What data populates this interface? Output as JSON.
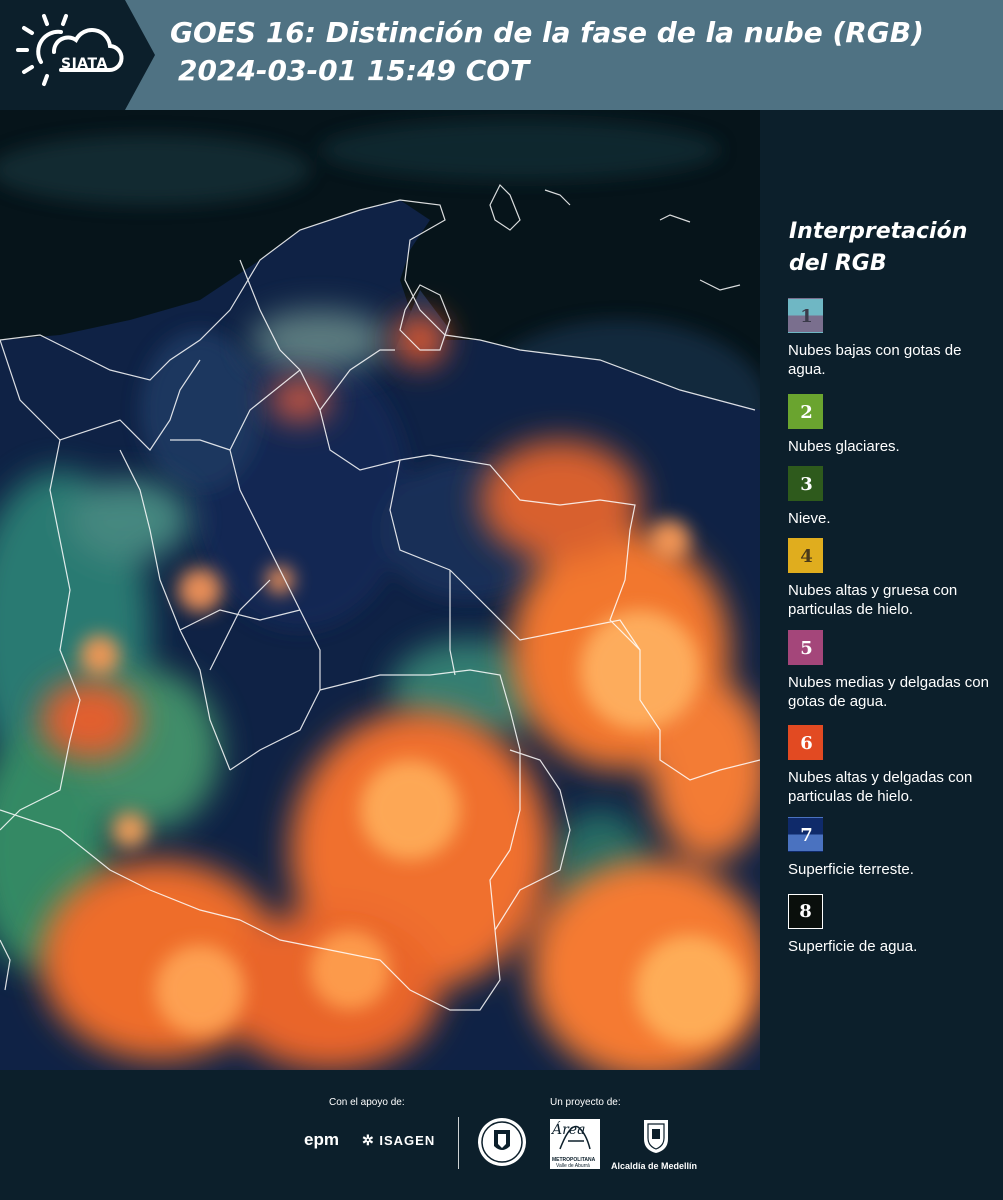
{
  "header": {
    "logo_text": "SIATA",
    "title_line1": "GOES 16: Distinción de la fase de la nube (RGB)",
    "title_line2": "2024-03-01 15:49 COT"
  },
  "map": {
    "icon": "satellite-rgb-map"
  },
  "legend": {
    "title": "Interpretación del RGB",
    "items": [
      {
        "number": "1",
        "label": "Nubes bajas con gotas de agua.",
        "top_color": "#6fb7c4",
        "bottom_color": "#7a6f8e",
        "num_color": "#3a3a4a"
      },
      {
        "number": "2",
        "label": "Nubes glaciares.",
        "top_color": "#6aa42f",
        "bottom_color": "#6aa42f",
        "num_color": "#ffffff"
      },
      {
        "number": "3",
        "label": "Nieve.",
        "top_color": "#2e5a1c",
        "bottom_color": "#2e5a1c",
        "num_color": "#ffffff"
      },
      {
        "number": "4",
        "label": "Nubes altas y gruesa con particulas de hielo.",
        "top_color": "#e0ad1e",
        "bottom_color": "#e0ad1e",
        "num_color": "#4a3a1a"
      },
      {
        "number": "5",
        "label": "Nubes medias y delgadas con gotas de agua.",
        "top_color": "#a4467a",
        "bottom_color": "#a4467a",
        "num_color": "#ffffff"
      },
      {
        "number": "6",
        "label": "Nubes altas y delgadas con particulas de hielo.",
        "top_color": "#e24a22",
        "bottom_color": "#e24a22",
        "num_color": "#ffffff"
      },
      {
        "number": "7",
        "label": "Superficie terreste.",
        "top_color": "#0f2a6a",
        "bottom_color": "#4a72c0",
        "num_color": "#ffffff"
      },
      {
        "number": "8",
        "label": "Superficie de agua.",
        "top_color": "#0a0f0c",
        "bottom_color": "#0a0f0c",
        "num_color": "#ffffff"
      }
    ]
  },
  "footer": {
    "support_label": "Con el apoyo de:",
    "project_label": "Un proyecto de:",
    "epm": "epm",
    "isagen": "ISAGEN",
    "area_word": "Área",
    "area_sub1": "METROPOLITANA",
    "area_sub2": "Valle de Aburrá",
    "alcaldia": "Alcaldía de Medellín"
  }
}
